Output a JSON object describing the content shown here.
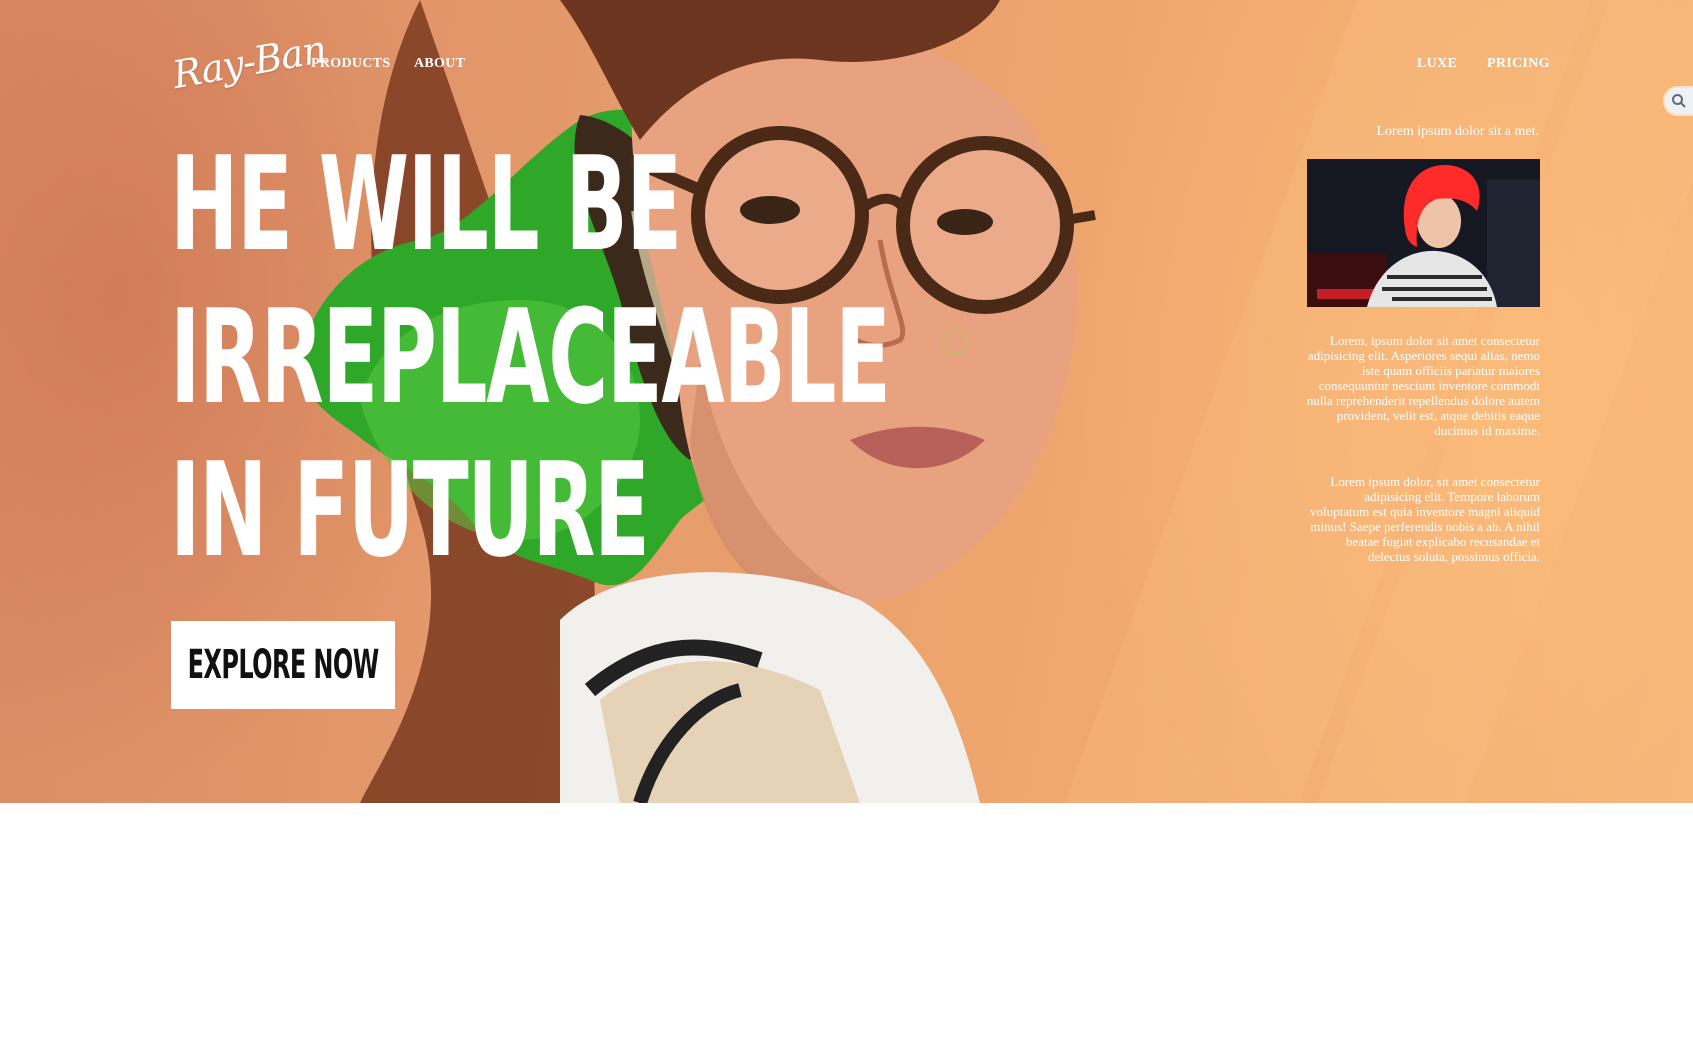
{
  "brand": {
    "logo_text": "Ray-Ban"
  },
  "nav": {
    "left": [
      "PRODUCTS",
      "ABOUT"
    ],
    "right": [
      "LUXE",
      "PRICING"
    ]
  },
  "hero": {
    "headline_lines": [
      "HE WILL BE",
      "IRREPLACEABLE",
      "IN FUTURE"
    ],
    "cta_label": "EXPLORE NOW"
  },
  "sidebar": {
    "tagline": "Lorem ipsum dolor sit a met.",
    "paragraph_1": "Lorem, ipsum dolor sit amet consectetur adipisicing elit. Asperiores sequi alias, nemo iste quam officiis pariatur maiores consequuntur nesciunt inventore commodi nulla reprehenderit repellendus dolore autem provident, velit est, atque debitis eaque ducimus id maxime.",
    "paragraph_2": "Lorem ipsum dolor, sit amet consectetur adipisicing elit. Tempore laborum voluptatum est quia inventore magni aliquid minus! Saepe perferendis nobis a ab. A nihil beatae fugiat explicabo recusandae et delectus soluta, possimus officia."
  },
  "icons": {
    "search": "search-icon"
  },
  "colors": {
    "hero_base": "#e59a6b",
    "green_blob": "#2fa82a",
    "text": "#ffffff",
    "cta_bg": "#ffffff",
    "cta_text": "#111111",
    "thumb_hair": "#ff2b2b"
  }
}
